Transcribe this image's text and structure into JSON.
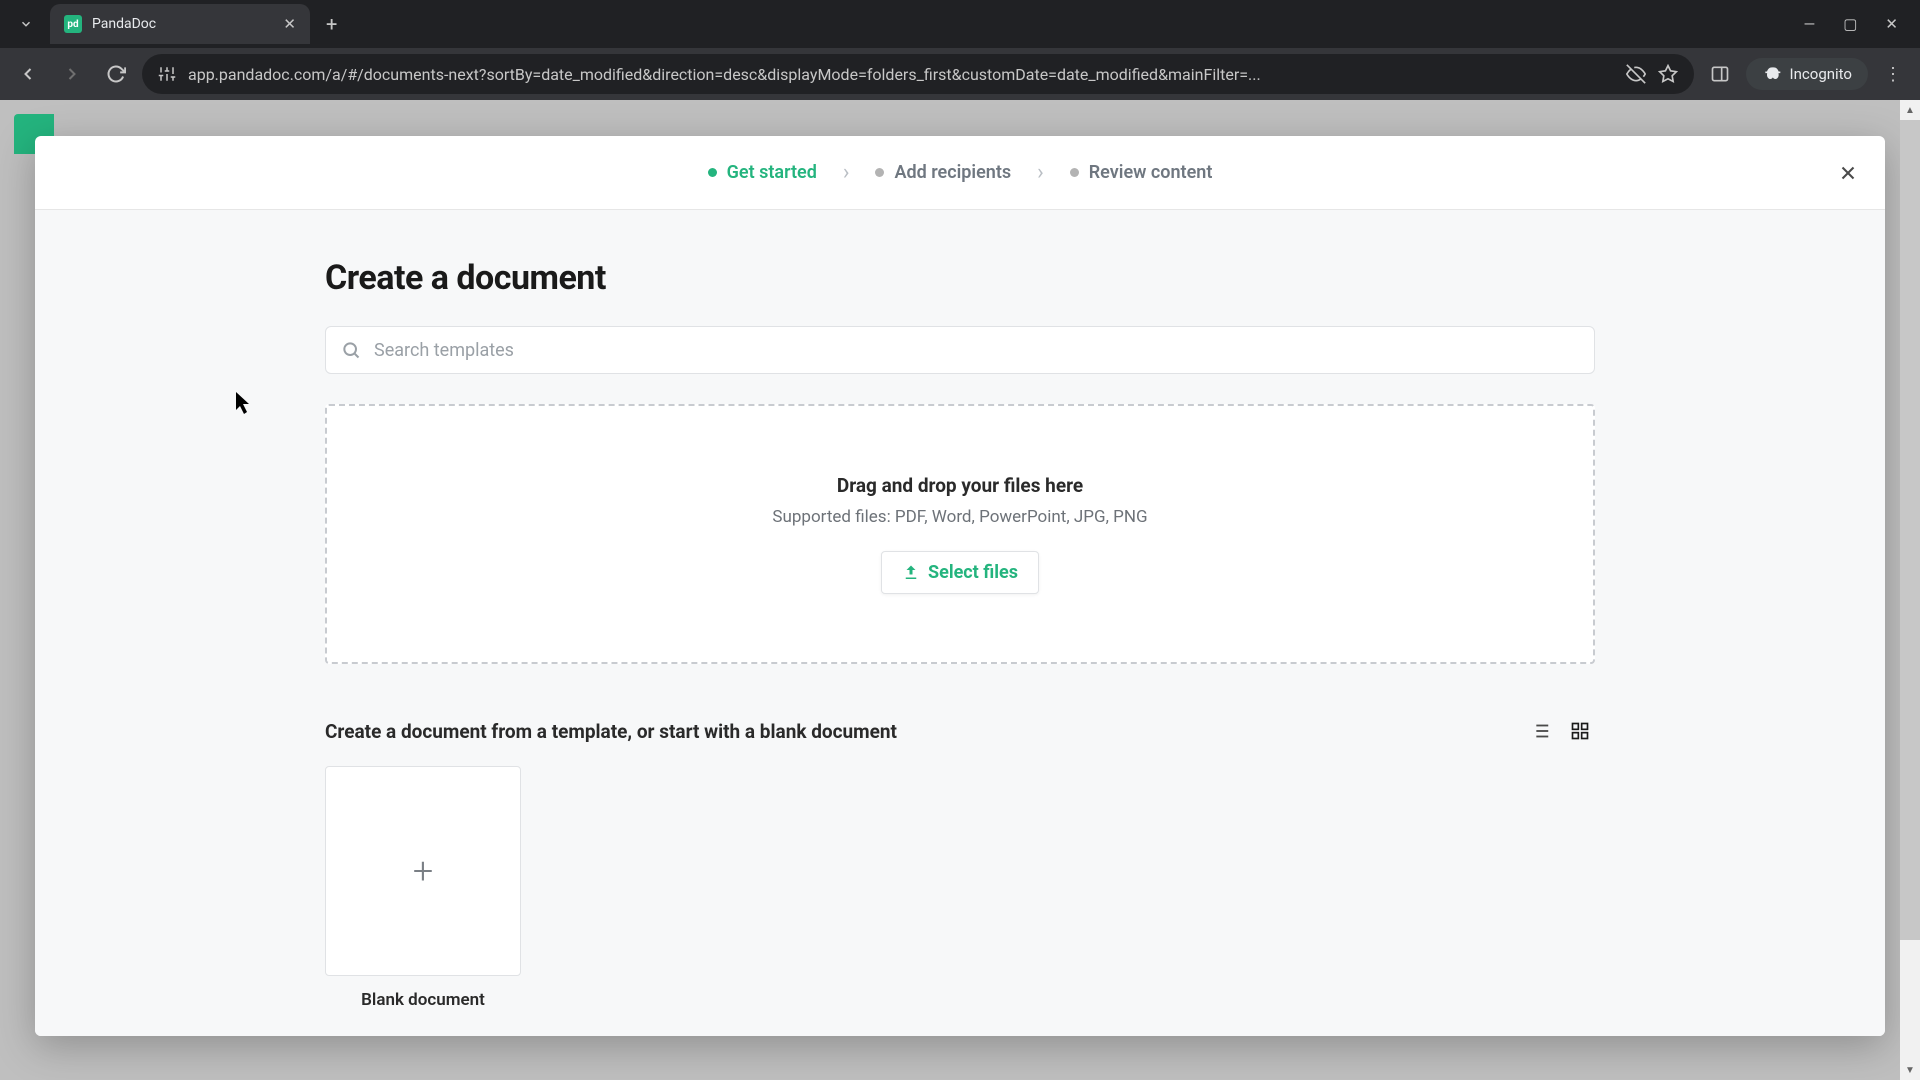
{
  "browser": {
    "tab_title": "PandaDoc",
    "url": "app.pandadoc.com/a/#/documents-next?sortBy=date_modified&direction=desc&displayMode=folders_first&customDate=date_modified&mainFilter=...",
    "incognito_label": "Incognito"
  },
  "stepper": {
    "steps": [
      {
        "label": "Get started",
        "active": true
      },
      {
        "label": "Add recipients",
        "active": false
      },
      {
        "label": "Review content",
        "active": false
      }
    ]
  },
  "page": {
    "title": "Create a document",
    "search_placeholder": "Search templates",
    "dropzone_title": "Drag and drop your files here",
    "dropzone_sub": "Supported files: PDF, Word, PowerPoint, JPG, PNG",
    "select_files_label": "Select files",
    "templates_heading": "Create a document from a template, or start with a blank document",
    "templates": [
      {
        "label": "Blank document"
      }
    ]
  }
}
